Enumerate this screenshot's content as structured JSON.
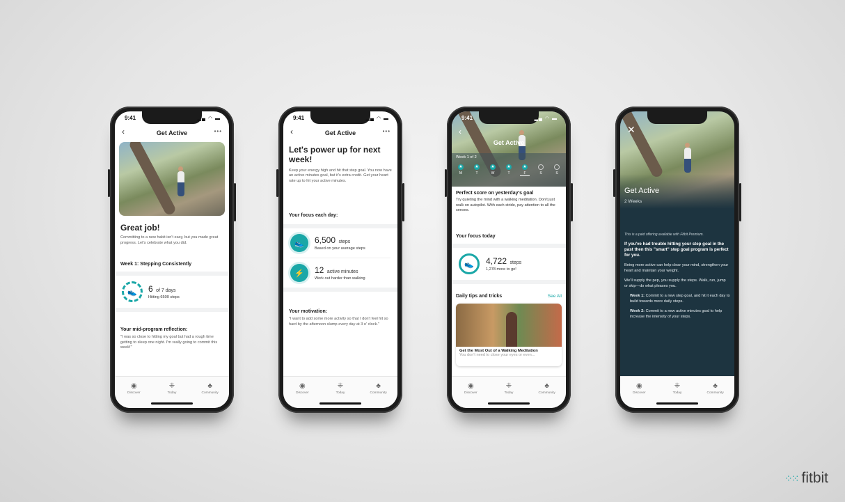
{
  "brand": "fitbit",
  "time": "9:41",
  "tabs": [
    "Discover",
    "Today",
    "Community"
  ],
  "phone1": {
    "nav_title": "Get Active",
    "heading": "Great job!",
    "body": "Committing to a new habit isn't easy, but you made great progress. Let's celebrate what you did.",
    "week_title": "Week 1: Stepping Consistently",
    "metric_value": "6",
    "metric_of": "of 7 days",
    "metric_sub": "Hitting 6500 steps",
    "reflection_title": "Your mid-program reflection:",
    "reflection": "\"I was so close to hitting my goal but had a rough time getting to sleep one night. I'm really going to commit this week!\""
  },
  "phone2": {
    "nav_title": "Get Active",
    "heading": "Let's power up for next week!",
    "body": "Keep your energy high and hit that step goal. You now have an active minutes goal, but it's extra credit. Get your heart rate up to hit your active minutes.",
    "focus_title": "Your focus each day:",
    "m1_value": "6,500",
    "m1_unit": "steps",
    "m1_sub": "Based on your average steps",
    "m2_value": "12",
    "m2_unit": "active minutes",
    "m2_sub": "Work out harder than walking",
    "motivation_title": "Your motivation:",
    "motivation": "\"I want to add some more activity so that I don't feel hit so hard by the afternoon slump every day at 3 o' clock.\""
  },
  "phone3": {
    "nav_title": "Get Active",
    "week_label": "Week 1 of 2",
    "days": [
      "M",
      "T",
      "W",
      "T",
      "F",
      "S",
      "S"
    ],
    "score_title": "Perfect score on yesterday's goal",
    "score_body": "Try quieting the mind with a walking meditation. Don't just walk on autopilot. With each stride, pay attention to all the senses.",
    "focus_title": "Your focus today",
    "m_value": "4,722",
    "m_unit": "steps",
    "m_sub": "1,278 more to go!",
    "tips_title": "Daily tips and tricks",
    "see_all": "See All",
    "article_title": "Get the Most Out of a Walking Meditation",
    "article_sub": "You don't need to close your eyes or even..."
  },
  "phone4": {
    "hero_title": "Get Active",
    "hero_sub": "2 Weeks",
    "paid_note": "This is a paid offering available with Fitbit Premium.",
    "lead": "If you've had trouble hitting your step goal in the past then this \"smart\" step goal program is perfect for you.",
    "p1": "Being more active can help clear your mind, strengthen your heart and maintain your weight.",
    "p2": "We'll supply the pep, you supply the steps. Walk, run, jump or skip—do what pleases you.",
    "w1_label": "Week 1:",
    "w1_text": "Commit to a new step goal, and hit it each day to build towards more daily steps.",
    "w2_label": "Week 2:",
    "w2_text": "Commit to a new active minutes goal to help increase the intensity of your steps."
  }
}
